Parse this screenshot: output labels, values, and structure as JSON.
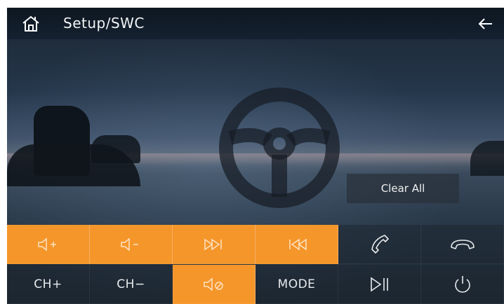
{
  "header": {
    "title": "Setup/SWC",
    "home_icon": "home-icon",
    "back_icon": "back-arrow-icon"
  },
  "center_icon": "steering-wheel-icon",
  "clear_all_label": "Clear All",
  "colors": {
    "accent": "#f5962a",
    "topbar": "#0e1721",
    "button_dark": "#1e2630"
  },
  "buttons": {
    "row1": [
      {
        "name": "volume-up",
        "icon": "volume-up-icon",
        "active": true
      },
      {
        "name": "volume-down",
        "icon": "volume-down-icon",
        "active": true
      },
      {
        "name": "next-track",
        "icon": "fast-forward-icon",
        "active": true
      },
      {
        "name": "previous-track",
        "icon": "rewind-icon",
        "active": true
      },
      {
        "name": "answer-call",
        "icon": "phone-icon",
        "active": false
      },
      {
        "name": "hang-up",
        "icon": "hang-up-icon",
        "active": false
      }
    ],
    "row2": [
      {
        "name": "channel-up",
        "label": "CH+",
        "active": false
      },
      {
        "name": "channel-down",
        "label": "CH−",
        "active": false
      },
      {
        "name": "mute",
        "icon": "mute-icon",
        "active": true
      },
      {
        "name": "mode",
        "label": "MODE",
        "active": false
      },
      {
        "name": "play-pause",
        "icon": "play-pause-icon",
        "active": false
      },
      {
        "name": "power",
        "icon": "power-icon",
        "active": false
      }
    ]
  }
}
